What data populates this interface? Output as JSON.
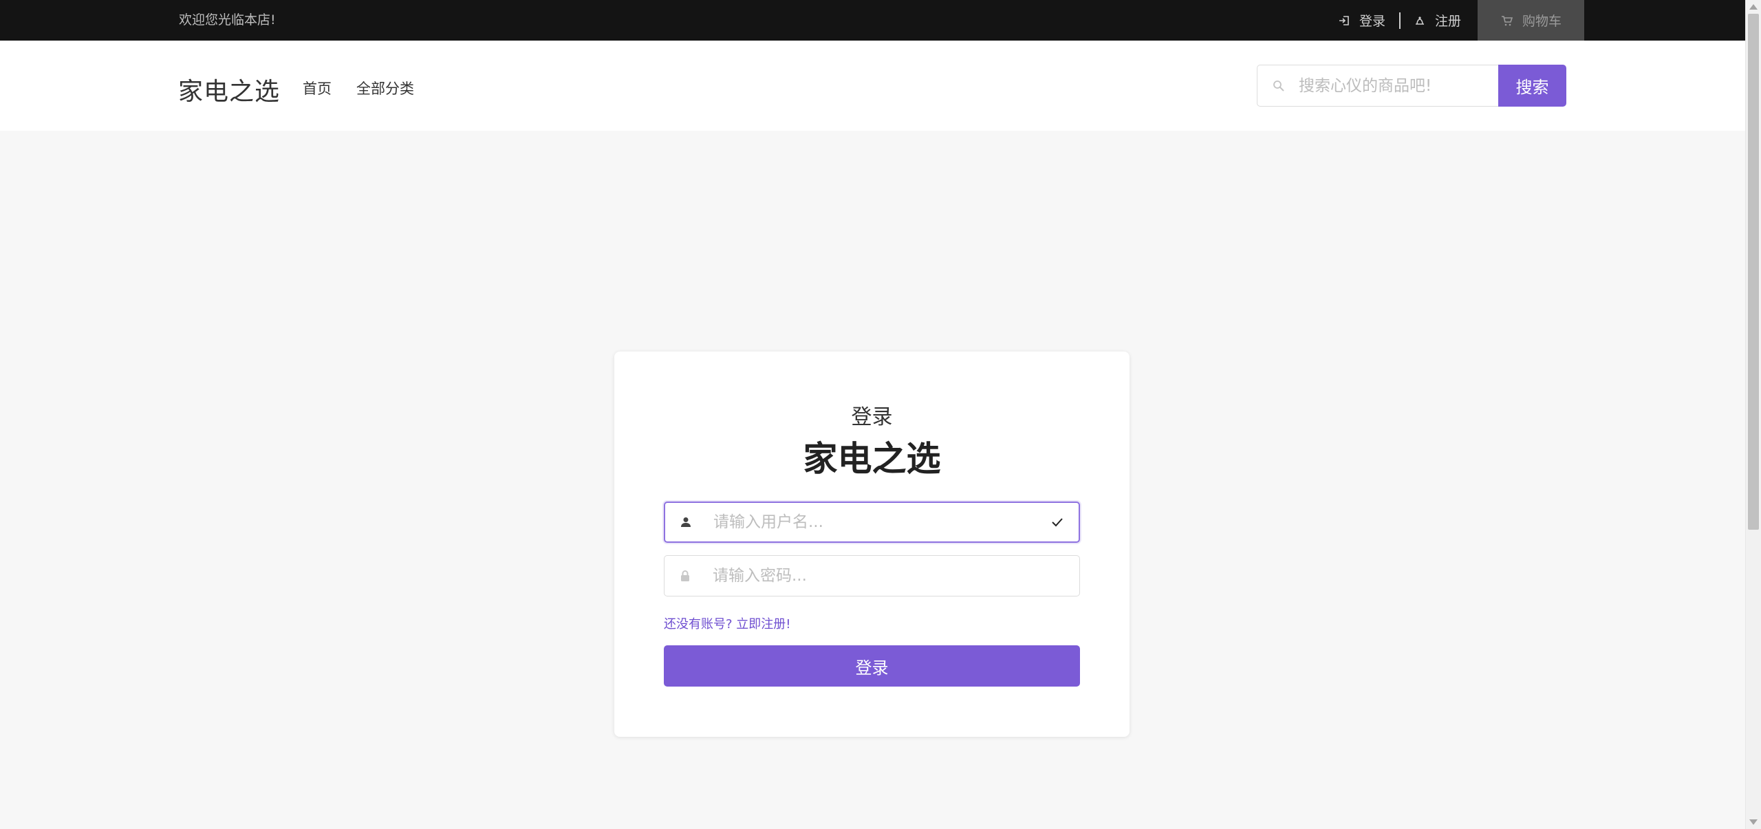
{
  "topbar": {
    "welcome": "欢迎您光临本店!",
    "login_label": "登录",
    "register_label": "注册",
    "cart_label": "购物车"
  },
  "header": {
    "brand": "家电之选",
    "nav": [
      {
        "label": "首页"
      },
      {
        "label": "全部分类"
      }
    ],
    "search": {
      "placeholder": "搜索心仪的商品吧!",
      "button_label": "搜索"
    }
  },
  "login": {
    "subtitle": "登录",
    "title": "家电之选",
    "username_placeholder": "请输入用户名...",
    "password_placeholder": "请输入密码...",
    "register_link": "还没有账号? 立即注册!",
    "submit_label": "登录"
  },
  "icons": {
    "login": "login-icon",
    "register": "register-icon",
    "cart": "cart-icon",
    "search": "search-icon",
    "user": "user-icon",
    "lock": "lock-icon",
    "check": "check-icon"
  },
  "colors": {
    "accent": "#7b5bd6",
    "topbar_bg": "#141414",
    "page_bg": "#f7f7f7",
    "focus_border": "#8e72e0"
  }
}
